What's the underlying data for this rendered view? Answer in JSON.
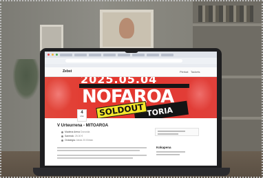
{
  "browser": {
    "tab_colors": [
      "#e54b4b",
      "#f2b134",
      "#4caf50"
    ]
  },
  "site": {
    "brand": "Zebst",
    "nav": [
      "Pierkat",
      "Tackets"
    ]
  },
  "banner": {
    "top_text": "2025.05.04",
    "headline": "NOFAROA",
    "sticker": "SOLDOUT",
    "strip_text": "TORIA",
    "colors": {
      "background": "#e5352d",
      "sticker": "#f3e62b"
    }
  },
  "event": {
    "date_day": "4",
    "date_month": "MEI",
    "title": "V Urteurrena - MITOAROA",
    "meta": [
      {
        "label": "Madena Arena",
        "muted": "Donostia"
      },
      {
        "label": "Sarrerak: ",
        "muted": "25.00 €"
      },
      {
        "label": "Ordutegia: ",
        "muted": "Ateak 20:00etan"
      }
    ],
    "side_heading": "Kokapena"
  }
}
